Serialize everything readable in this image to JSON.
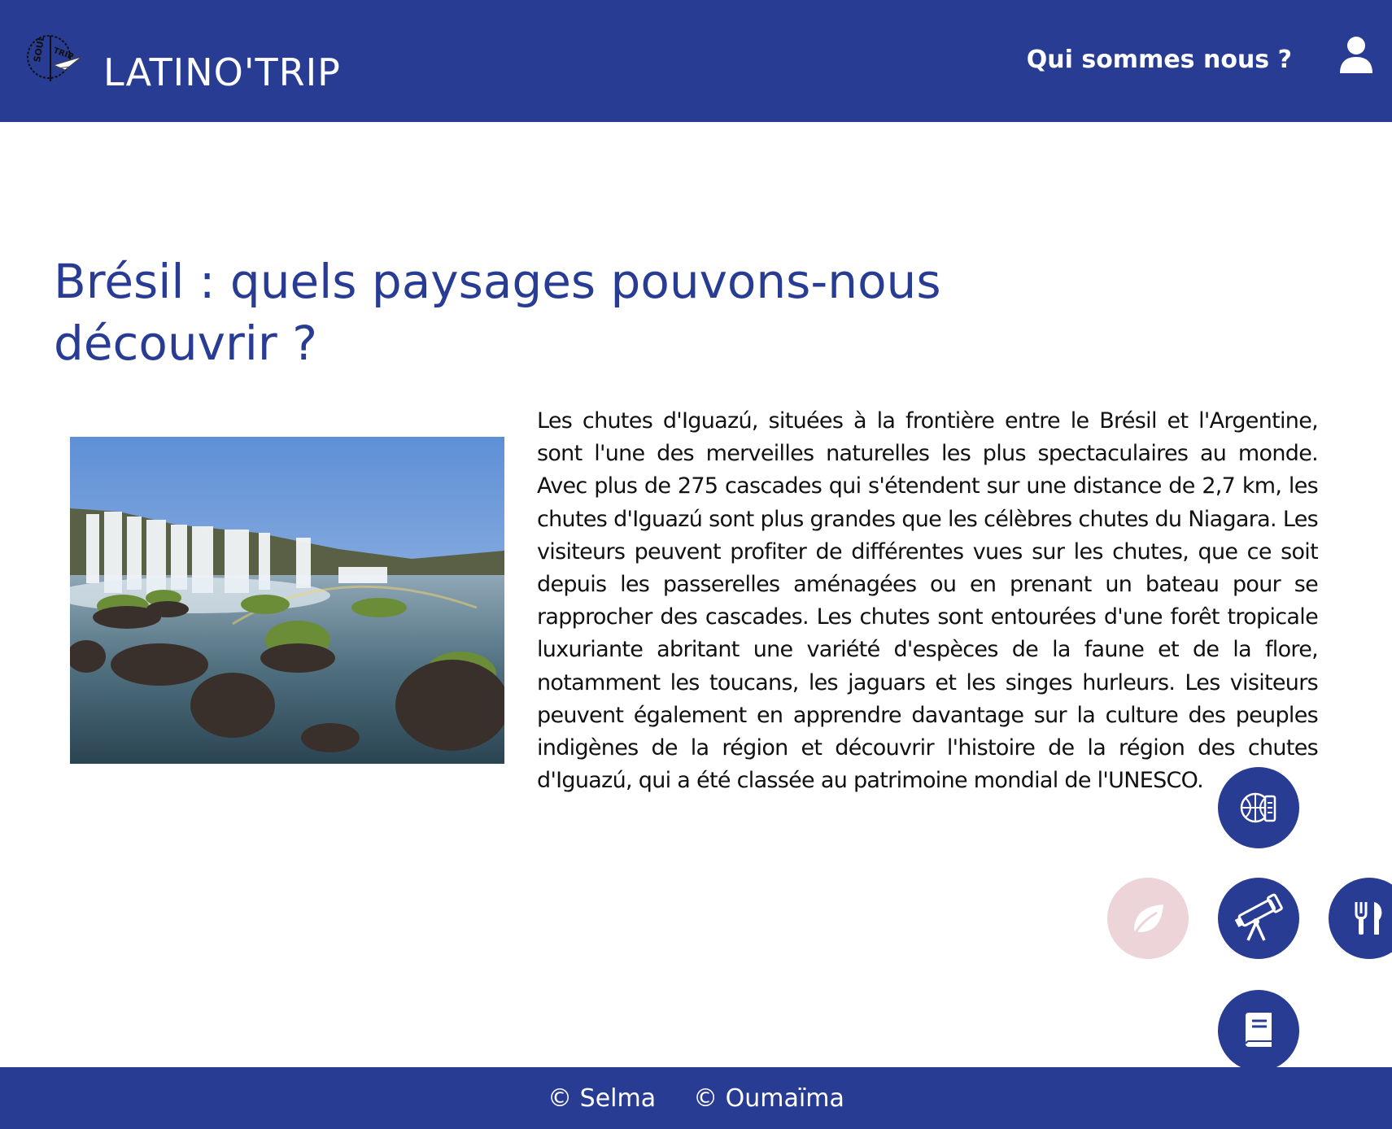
{
  "header": {
    "brand": "LATINO'TRIP",
    "logo_text": "SOUL TRIP",
    "nav_about": "Qui sommes nous ?",
    "icons": {
      "account": "user-icon"
    }
  },
  "article": {
    "title": "Brésil : quels paysages pouvons-nous découvrir ?",
    "image_subject": "waterfall-photo",
    "body": "Les chutes d'Iguazú, situées à la frontière entre le Brésil et l'Argentine, sont l'une des merveilles naturelles les plus spectaculaires au monde. Avec plus de 275 cascades qui s'étendent sur une distance de 2,7 km, les chutes d'Iguazú sont plus grandes que les célèbres chutes du Niagara. Les visiteurs peuvent profiter de différentes vues sur les chutes, que ce soit depuis les passerelles aménagées ou en prenant un bateau pour se rapprocher des cascades. Les chutes sont entourées d'une forêt tropicale luxuriante abritant une variété d'espèces de la faune et de la flore, notamment les toucans, les jaguars et les singes hurleurs. Les visiteurs peuvent également en apprendre davantage sur la culture des peuples indigènes de la région et découvrir l'histoire de la région des chutes d'Iguazú, qui a été classée au patrimoine mondial de l'UNESCO."
  },
  "quick_menu": {
    "items": [
      "sport-and-drink-icon",
      "leaf-icon",
      "telescope-icon",
      "fork-and-knife-icon",
      "book-icon"
    ],
    "active": "telescope-icon"
  },
  "footer": {
    "credit_1": "© Selma",
    "credit_2": "© Oumaïma"
  },
  "colors": {
    "primary": "#283c94",
    "soft_pink": "#ecd4d8",
    "text": "#111111",
    "background": "#ffffff"
  }
}
